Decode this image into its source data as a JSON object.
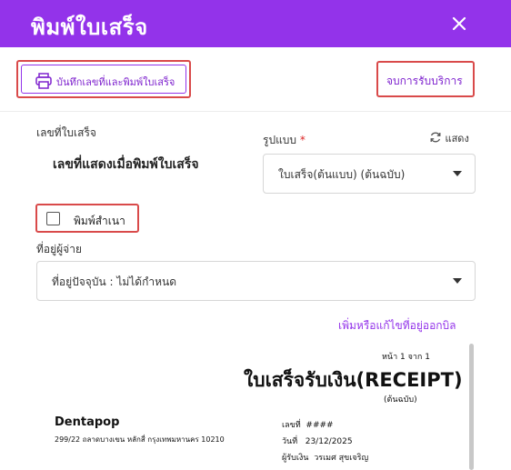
{
  "header": {
    "title": "พิมพ์ใบเสร็จ",
    "close_icon": "close-icon"
  },
  "toolbar": {
    "print_button_label": "บันทึกเลขที่และพิมพ์ใบเสร็จ",
    "print_icon": "printer-icon",
    "end_service_label": "จบการรับบริการ"
  },
  "form": {
    "receipt_no_label": "เลขที่ใบเสร็จ",
    "receipt_no_value": "เลขที่แสดงเมื่อพิมพ์ใบเสร็จ",
    "format_label": "รูปแบบ",
    "required_mark": "*",
    "show_label": "แสดง",
    "format_value": "ใบเสร็จ(ต้นแบบ) (ต้นฉบับ)",
    "copy_label": "พิมพ์สำเนา",
    "copy_checked": false,
    "payer_address_label": "ที่อยู่ผู้จ่าย",
    "payer_address_value": "ที่อยู่ปัจจุบัน : ไม่ได้กำหนด",
    "address_link": "เพิ่มหรือแก้ไขที่อยู่ออกบิล"
  },
  "preview": {
    "page_indicator": "หน้า 1 จาก 1",
    "title": "ใบเสร็จรับเงิน(RECEIPT)",
    "subtitle": "(ต้นฉบับ)",
    "clinic_name": "Dentapop",
    "clinic_address": "299/22 ถลาดบางเขน หลักสี่ กรุงเทพมหานคร 10210",
    "no_label": "เลขที่",
    "no_value": "####",
    "date_label": "วันที่",
    "date_value": "23/12/2025",
    "receiver_label": "ผู้รับเงิน",
    "receiver_value": "วรเมศ สุขเจริญ"
  },
  "colors": {
    "accent": "#9333ea",
    "highlight": "#d94a4a",
    "required": "#dc2626"
  }
}
